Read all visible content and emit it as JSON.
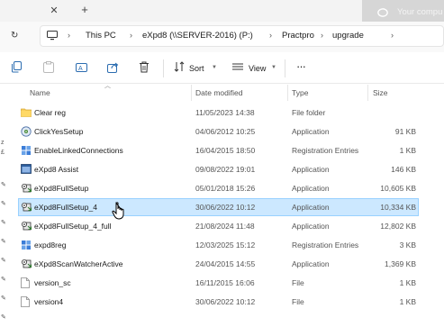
{
  "tabs": {
    "close_icon": "close-icon",
    "new_tab_icon": "plus-icon"
  },
  "notification": {
    "text": "Your compu"
  },
  "address": {
    "crumbs": [
      "This PC",
      "eXpd8 (\\\\SERVER-2016) (P:)",
      "Practpro",
      "upgrade"
    ]
  },
  "toolbar": {
    "sort_label": "Sort",
    "view_label": "View"
  },
  "columns": {
    "name": "Name",
    "date": "Date modified",
    "type": "Type",
    "size": "Size"
  },
  "left_strip": [
    "z",
    "£",
    "✎",
    "✎",
    "✎",
    "✎",
    "✎",
    "✎",
    "✎",
    "✎"
  ],
  "files": [
    {
      "name": "Clear reg",
      "date": "11/05/2023 14:38",
      "type": "File folder",
      "size": "",
      "icon": "folder-icon"
    },
    {
      "name": "ClickYesSetup",
      "date": "04/06/2012 10:25",
      "type": "Application",
      "size": "91 KB",
      "icon": "setup-disc-icon"
    },
    {
      "name": "EnableLinkedConnections",
      "date": "16/04/2015 18:50",
      "type": "Registration Entries",
      "size": "1 KB",
      "icon": "registry-icon"
    },
    {
      "name": "eXpd8 Assist",
      "date": "09/08/2022 19:01",
      "type": "Application",
      "size": "146 KB",
      "icon": "app-window-icon"
    },
    {
      "name": "eXpd8FullSetup",
      "date": "05/01/2018 15:26",
      "type": "Application",
      "size": "10,605 KB",
      "icon": "installer-icon"
    },
    {
      "name": "eXpd8FullSetup_4",
      "date": "30/06/2022 10:12",
      "type": "Application",
      "size": "10,334 KB",
      "icon": "installer-icon",
      "selected": true
    },
    {
      "name": "eXpd8FullSetup_4_full",
      "date": "21/08/2024 11:48",
      "type": "Application",
      "size": "12,802 KB",
      "icon": "installer-icon"
    },
    {
      "name": "expd8reg",
      "date": "12/03/2025 15:12",
      "type": "Registration Entries",
      "size": "3 KB",
      "icon": "registry-icon"
    },
    {
      "name": "eXpd8ScanWatcherActive",
      "date": "24/04/2015 14:55",
      "type": "Application",
      "size": "1,369 KB",
      "icon": "installer-icon"
    },
    {
      "name": "version_sc",
      "date": "16/11/2015 16:06",
      "type": "File",
      "size": "1 KB",
      "icon": "file-icon"
    },
    {
      "name": "version4",
      "date": "30/06/2022 10:12",
      "type": "File",
      "size": "1 KB",
      "icon": "file-icon"
    }
  ]
}
